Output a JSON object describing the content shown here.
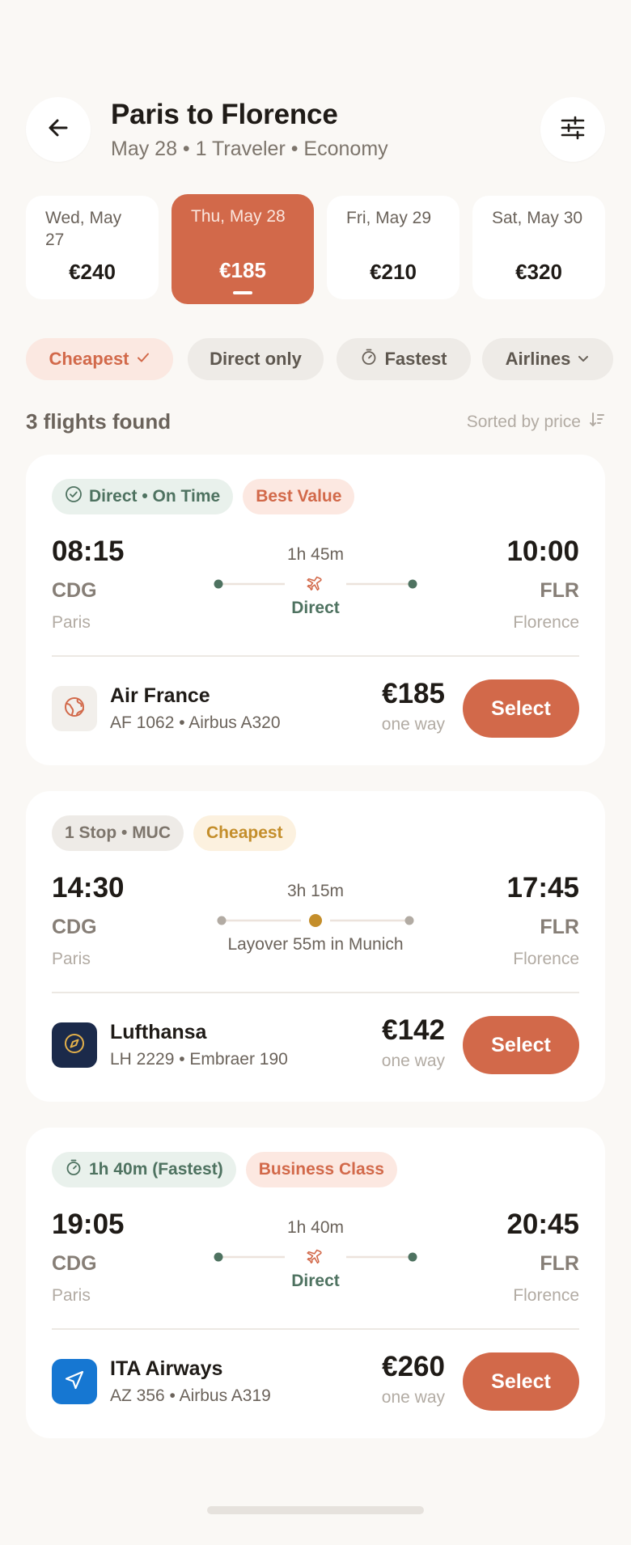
{
  "header": {
    "title": "Paris to Florence",
    "subtitle": "May 28 • 1 Traveler • Economy",
    "back_icon": "arrow-left-icon",
    "filter_icon": "sliders-icon"
  },
  "dates": [
    {
      "label": "Wed, May 27",
      "price": "€240",
      "active": false
    },
    {
      "label": "Thu, May 28",
      "price": "€185",
      "active": true
    },
    {
      "label": "Fri, May 29",
      "price": "€210",
      "active": false
    },
    {
      "label": "Sat, May 30",
      "price": "€320",
      "active": false
    }
  ],
  "filters": [
    {
      "label": "Cheapest",
      "icon": "check-icon",
      "active": true
    },
    {
      "label": "Direct only",
      "active": false
    },
    {
      "label": "Fastest",
      "icon": "stopwatch-icon",
      "active": false
    },
    {
      "label": "Airlines",
      "icon": "chevron-down-icon",
      "active": false
    }
  ],
  "results": {
    "count_label": "3 flights found",
    "sort_label": "Sorted by price",
    "sort_icon": "sort-icon"
  },
  "flights": [
    {
      "badges": [
        {
          "label": "Direct • On Time",
          "icon": "check-circle-icon",
          "style": "green"
        },
        {
          "label": "Best Value",
          "style": "orange"
        }
      ],
      "departure": {
        "time": "08:15",
        "code": "CDG",
        "city": "Paris"
      },
      "arrival": {
        "time": "10:00",
        "code": "FLR",
        "city": "Florence"
      },
      "duration": "1h 45m",
      "route_note": "Direct",
      "airline": "Air France",
      "flight_info": "AF 1062 • Airbus A320",
      "logo_icon": "globe-icon",
      "price": "€185",
      "price_note": "one way",
      "select_label": "Select"
    },
    {
      "badges": [
        {
          "label": "1 Stop • MUC",
          "style": "gray"
        },
        {
          "label": "Cheapest",
          "style": "gold"
        }
      ],
      "departure": {
        "time": "14:30",
        "code": "CDG",
        "city": "Paris"
      },
      "arrival": {
        "time": "17:45",
        "code": "FLR",
        "city": "Florence"
      },
      "duration": "3h 15m",
      "route_note": "Layover 55m in Munich",
      "airline": "Lufthansa",
      "flight_info": "LH 2229 • Embraer 190",
      "logo_icon": "compass-icon",
      "price": "€142",
      "price_note": "one way",
      "select_label": "Select"
    },
    {
      "badges": [
        {
          "label": "1h 40m (Fastest)",
          "icon": "stopwatch-icon",
          "style": "green"
        },
        {
          "label": "Business Class",
          "style": "orange"
        }
      ],
      "departure": {
        "time": "19:05",
        "code": "CDG",
        "city": "Paris"
      },
      "arrival": {
        "time": "20:45",
        "code": "FLR",
        "city": "Florence"
      },
      "duration": "1h 40m",
      "route_note": "Direct",
      "airline": "ITA Airways",
      "flight_info": "AZ 356 • Airbus A319",
      "logo_icon": "navigation-arrow-icon",
      "price": "€260",
      "price_note": "one way",
      "select_label": "Select"
    }
  ],
  "colors": {
    "accent": "#d2694a",
    "route_green": "#4e7260",
    "layover_gold": "#c48e2b",
    "background": "#faf8f5"
  }
}
